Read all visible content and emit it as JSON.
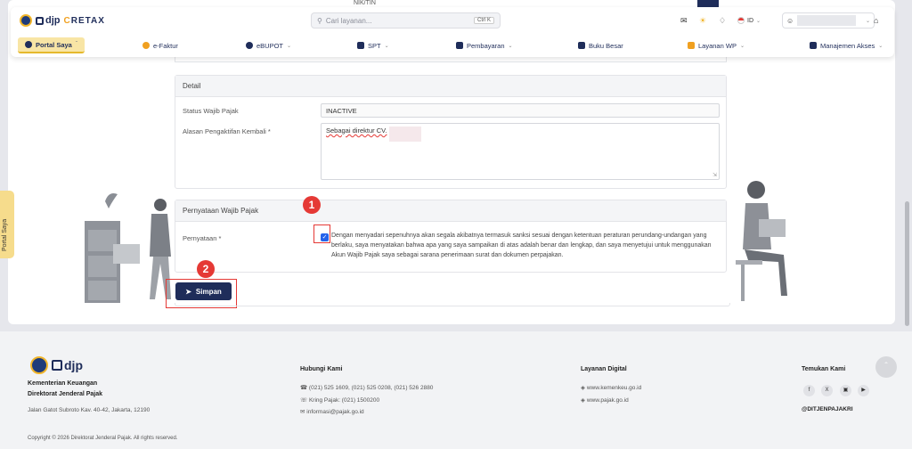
{
  "brand": {
    "djp": "djp",
    "coretax_a": "C",
    "coretax_b": "RETAX"
  },
  "search": {
    "placeholder": "Cari layanan...",
    "shortcut": "Ctrl K"
  },
  "topbar": {
    "language": "ID"
  },
  "nav": [
    {
      "label": "Portal Saya",
      "icon": "portal-icon"
    },
    {
      "label": "e-Faktur",
      "icon": "efaktur-icon"
    },
    {
      "label": "eBUPOT",
      "icon": "ebupot-icon"
    },
    {
      "label": "SPT",
      "icon": "spt-icon"
    },
    {
      "label": "Pembayaran",
      "icon": "payment-icon"
    },
    {
      "label": "Buku Besar",
      "icon": "ledger-icon"
    },
    {
      "label": "Layanan WP",
      "icon": "services-icon"
    },
    {
      "label": "Manajemen Akses",
      "icon": "access-icon"
    }
  ],
  "form": {
    "top_hint": "NIK/TIN",
    "detail": {
      "title": "Detail",
      "status_label": "Status Wajib Pajak",
      "status_value": "INACTIVE",
      "reason_label": "Alasan Pengaktifan Kembali *",
      "reason_value": "Sebagai direktur CV."
    },
    "statement": {
      "title": "Pernyataan Wajib Pajak",
      "label": "Pernyataan *",
      "checked": true,
      "text": "Dengan menyadari sepenuhnya akan segala akibatnya termasuk sanksi sesuai dengan ketentuan peraturan perundang-undangan yang berlaku, saya menyatakan bahwa apa yang saya sampaikan di atas adalah benar dan lengkap, dan saya menyetujui untuk menggunakan Akun Wajib Pajak saya sebagai sarana penerimaan surat dan dokumen perpajakan."
    },
    "submit_label": "Simpan"
  },
  "annotations": {
    "one": "1",
    "two": "2"
  },
  "portal_tab": {
    "label": "Portal Saya"
  },
  "footer": {
    "org_line1": "Kementerian Keuangan",
    "org_line2": "Direktorat Jenderal Pajak",
    "address": "Jalan Gatot Subroto Kav. 40-42, Jakarta, 12190",
    "contact_title": "Hubungi Kami",
    "phone": "(021) 525 1609, (021) 525 0208, (021) 526 2880",
    "kring": "Kring Pajak: (021) 1500200",
    "email": "informasi@pajak.go.id",
    "digital_title": "Layanan Digital",
    "site1": "www.kemenkeu.go.id",
    "site2": "www.pajak.go.id",
    "social_title": "Temukan Kami",
    "handle": "@DITJENPAJAKRI",
    "copyright": "Copyright © 2026 Direktorat Jenderal Pajak. All rights reserved."
  },
  "colors": {
    "primary": "#1f2d5a",
    "accent": "#f0b429",
    "annotation": "#e53935",
    "checkbox": "#2563eb"
  }
}
